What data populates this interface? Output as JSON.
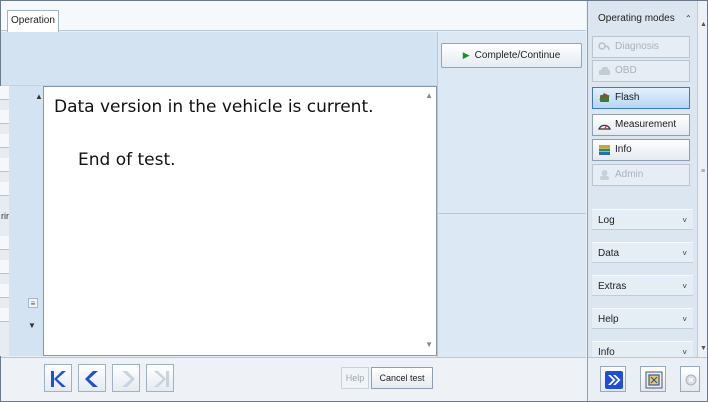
{
  "tab": {
    "label": "Operation"
  },
  "left_panel": {
    "cut_label": "rir",
    "eq_glyph": "≡"
  },
  "content": {
    "line1": "Data version in the vehicle is current.",
    "line2": "End of test."
  },
  "complete_button": {
    "label": "Complete/Continue"
  },
  "bottom": {
    "help_label": "Help",
    "cancel_label": "Cancel test"
  },
  "sidebar": {
    "operating_modes_label": "Operating modes",
    "modes": [
      {
        "label": "Diagnosis",
        "state": "disabled",
        "icon": "stethoscope-icon"
      },
      {
        "label": "OBD",
        "state": "disabled",
        "icon": "car-icon"
      },
      {
        "label": "Flash",
        "state": "active",
        "icon": "flash-chip-icon"
      },
      {
        "label": "Measurement",
        "state": "enabled",
        "icon": "gauge-icon"
      },
      {
        "label": "Info",
        "state": "enabled",
        "icon": "books-icon"
      },
      {
        "label": "Admin",
        "state": "disabled",
        "icon": "admin-icon"
      }
    ],
    "sections": [
      {
        "label": "Log"
      },
      {
        "label": "Data"
      },
      {
        "label": "Extras"
      },
      {
        "label": "Help"
      },
      {
        "label": "Info"
      }
    ]
  },
  "colors": {
    "accent_blue": "#1f4fd8",
    "play_green": "#1f8f2a",
    "active_mode": "#b7d6f3"
  }
}
